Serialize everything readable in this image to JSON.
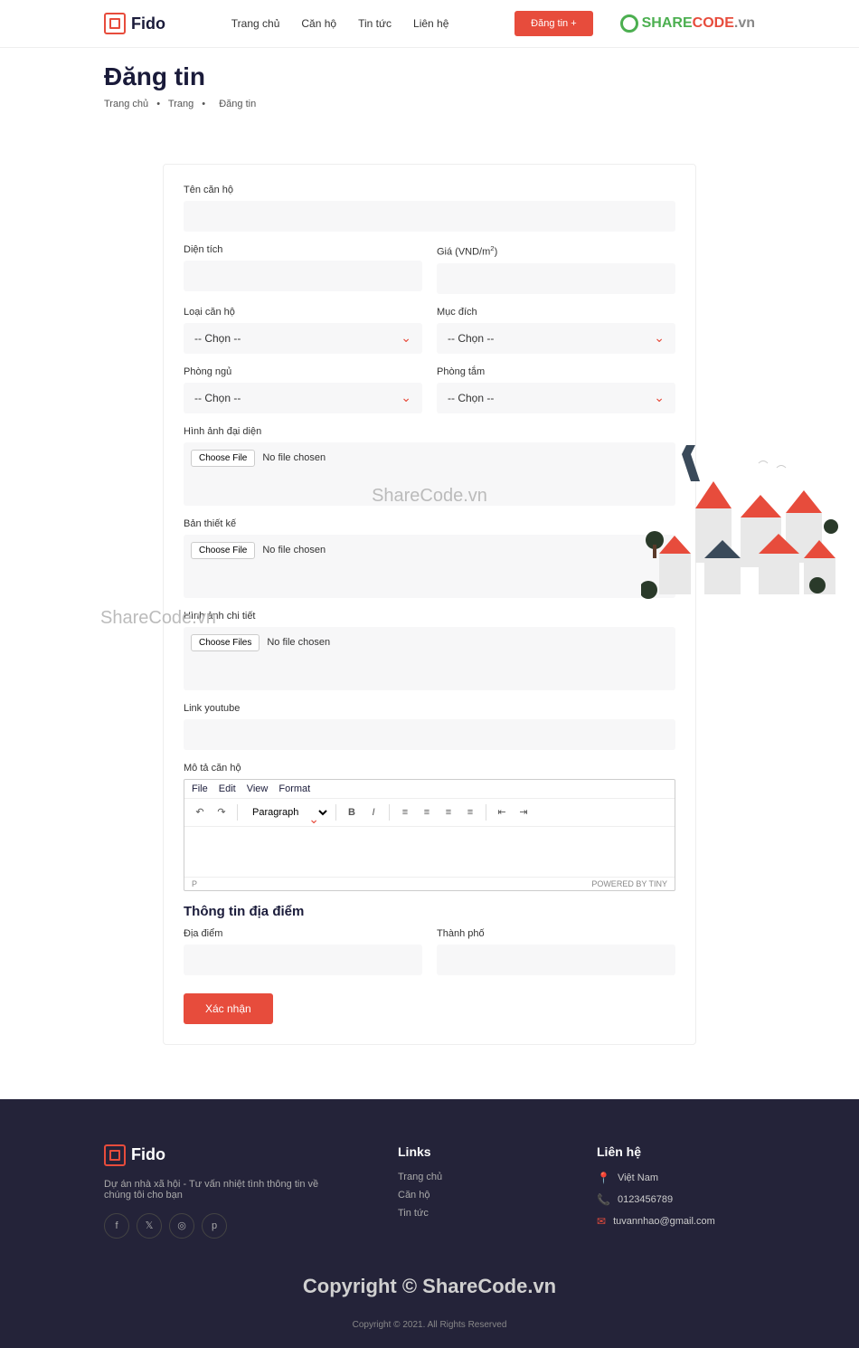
{
  "header": {
    "logo_text": "Fido",
    "nav": [
      "Trang chủ",
      "Căn hộ",
      "Tin tức",
      "Liên hệ"
    ],
    "post_btn": "Đăng tin +",
    "sharecode": {
      "share": "SHARE",
      "code": "CODE",
      "vn": ".vn"
    }
  },
  "breadcrumb": {
    "title": "Đăng tin",
    "items": [
      "Trang chủ",
      "Trang",
      "Đăng tin"
    ],
    "sep": "•"
  },
  "form": {
    "labels": {
      "name": "Tên căn hộ",
      "area": "Diện tích",
      "price": "Giá (VND/m",
      "price_sup": "2",
      "price_close": ")",
      "type": "Loại căn hộ",
      "purpose": "Mục đích",
      "bedroom": "Phòng ngủ",
      "bathroom": "Phòng tắm",
      "avatar": "Hình ảnh đại diện",
      "design": "Bản thiết kế",
      "detail": "Hình ảnh chi tiết",
      "youtube": "Link youtube",
      "desc": "Mô tả căn hộ",
      "location_section": "Thông tin địa điểm",
      "address": "Địa điểm",
      "city": "Thành phố"
    },
    "select_placeholder": "-- Chọn --",
    "file": {
      "choose_one": "Choose File",
      "choose_many": "Choose Files",
      "no_file": "No file chosen"
    },
    "editor": {
      "menu": [
        "File",
        "Edit",
        "View",
        "Format"
      ],
      "paragraph": "Paragraph",
      "status_left": "P",
      "status_right": "POWERED BY TINY"
    },
    "submit": "Xác nhận"
  },
  "watermarks": {
    "center": "ShareCode.vn",
    "left": "ShareCode.vn",
    "copyright": "Copyright © ShareCode.vn"
  },
  "footer": {
    "logo_text": "Fido",
    "tagline": "Dự án nhà xã hội - Tư vấn nhiệt tình thông tin về chúng tôi cho bạn",
    "links_title": "Links",
    "links": [
      "Trang chủ",
      "Căn hộ",
      "Tin tức"
    ],
    "contact_title": "Liên hệ",
    "contact": {
      "address": "Việt Nam",
      "phone": "0123456789",
      "email": "tuvannhao@gmail.com"
    },
    "bottom": "Copyright © 2021. All Rights Reserved"
  }
}
